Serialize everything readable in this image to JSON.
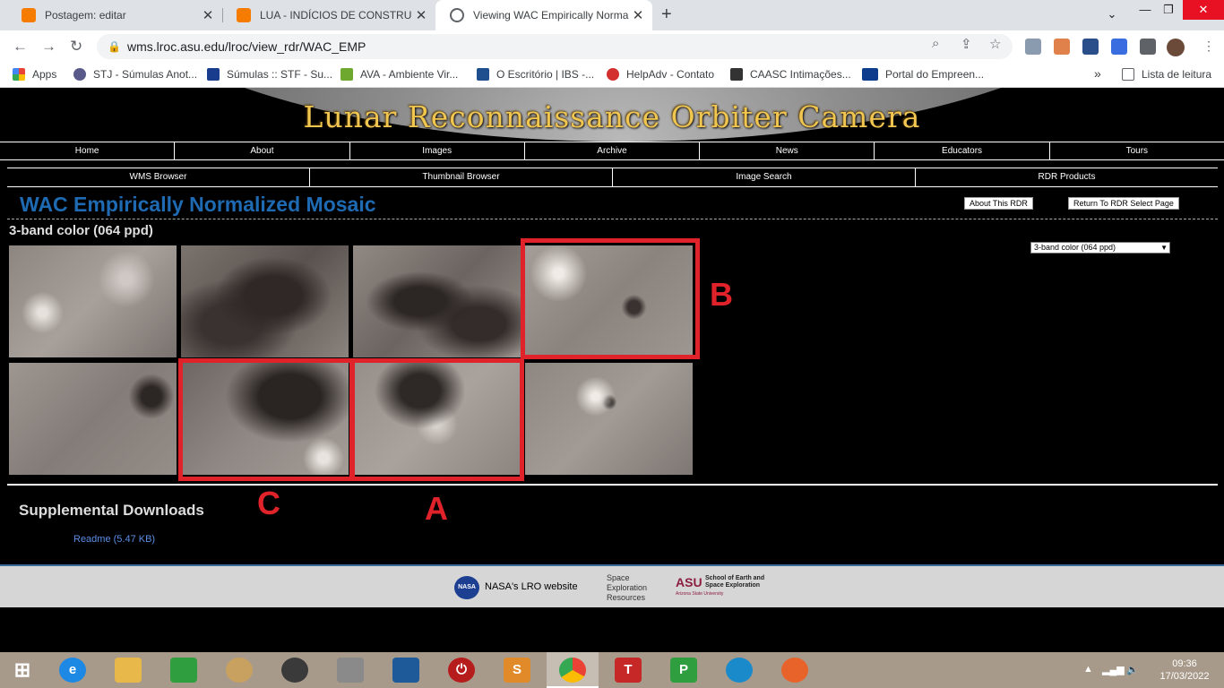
{
  "browser": {
    "tabs": [
      {
        "title": "Postagem: editar",
        "close": "✕",
        "favicon_color": "#f57c00"
      },
      {
        "title": "LUA - INDÍCIOS DE CONSTRUÇÕ",
        "close": "✕",
        "favicon_color": "#f57c00"
      },
      {
        "title": "Viewing WAC Empirically Norma",
        "close": "✕",
        "favicon_color": "#5f6368"
      }
    ],
    "new_tab": "+",
    "url": "wms.lroc.asu.edu/lroc/view_rdr/WAC_EMP",
    "window_controls": [
      "⌄",
      "—",
      "❐",
      "✕"
    ],
    "bookmarks": [
      {
        "label": "Apps",
        "color": "#e8453c"
      },
      {
        "label": "STJ - Súmulas Anot...",
        "color": "#5a5a8a"
      },
      {
        "label": "Súmulas :: STF - Su...",
        "color": "#1a3c8c"
      },
      {
        "label": "AVA - Ambiente Vir...",
        "color": "#6fa82f"
      },
      {
        "label": "O Escritório | IBS -...",
        "color": "#1f4f8f"
      },
      {
        "label": "HelpAdv - Contato",
        "color": "#d32f2f"
      },
      {
        "label": "CAASC Intimações...",
        "color": "#333333"
      },
      {
        "label": "Portal do Empreen...",
        "color": "#0d3c8c"
      }
    ],
    "bookmarks_more": "»",
    "reading_list": "Lista de leitura"
  },
  "site": {
    "banner_title": "Lunar Reconnaissance Orbiter Camera",
    "nav_primary": [
      "Home",
      "About",
      "Images",
      "Archive",
      "News",
      "Educators",
      "Tours"
    ],
    "nav_secondary": [
      "WMS Browser",
      "Thumbnail Browser",
      "Image Search",
      "RDR Products"
    ],
    "page_title": "WAC Empirically Normalized Mosaic",
    "about_button": "About This RDR",
    "return_button": "Return To RDR Select Page",
    "subtitle": "3-band color (064 ppd)",
    "select_value": "3-band color (064 ppd)",
    "tiles": [
      {
        "id": "tile-1"
      },
      {
        "id": "tile-2"
      },
      {
        "id": "tile-3"
      },
      {
        "id": "tile-4"
      },
      {
        "id": "tile-5"
      },
      {
        "id": "tile-6"
      },
      {
        "id": "tile-7"
      },
      {
        "id": "tile-8"
      }
    ],
    "annotations": {
      "a": "A",
      "b": "B",
      "c": "C"
    },
    "supplemental_title": "Supplemental Downloads",
    "readme_link": "Readme (5.47 KB)",
    "footer": {
      "nasa_logo": "NASA",
      "nasa_link": "NASA's LRO website",
      "space_exploration": "Space Exploration Resources",
      "asu": "ASU",
      "asu_school": "School of Earth and Space Exploration",
      "asu_university": "Arizona State University"
    }
  },
  "taskbar": {
    "time": "09:36",
    "date": "17/03/2022"
  }
}
